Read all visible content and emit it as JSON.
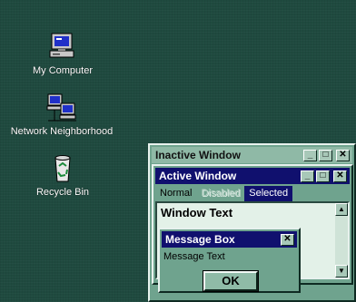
{
  "desktop": {
    "icons": [
      {
        "label": "My Computer",
        "icon": "my-computer-icon"
      },
      {
        "label": "Network Neighborhood",
        "icon": "network-neighborhood-icon"
      },
      {
        "label": "Recycle Bin",
        "icon": "recycle-bin-icon"
      }
    ]
  },
  "inactive_window": {
    "title": "Inactive Window",
    "buttons": {
      "minimize": "_",
      "maximize": "□",
      "close": "✕"
    }
  },
  "active_window": {
    "title": "Active Window",
    "buttons": {
      "minimize": "_",
      "maximize": "□",
      "close": "✕"
    },
    "menu": {
      "normal": "Normal",
      "disabled": "Disabled",
      "selected": "Selected"
    },
    "window_text": "Window Text",
    "scroll_up": "▲",
    "scroll_down": "▼"
  },
  "message_box": {
    "title": "Message Box",
    "close": "✕",
    "text": "Message Text",
    "ok_label": "OK"
  },
  "colors": {
    "desktop": "#1f4a3f",
    "window_face": "#6fa38e",
    "active_title": "#10106e",
    "inactive_title": "#8fb9a6",
    "window_background": "#e3f1e8"
  }
}
